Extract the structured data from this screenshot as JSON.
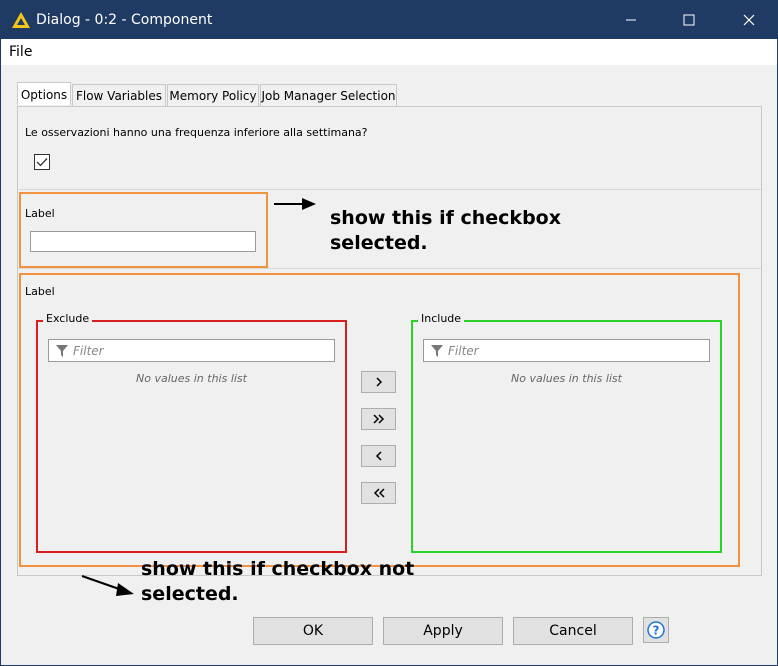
{
  "window": {
    "title": "Dialog - 0:2 - Component",
    "controls": [
      "minimize-icon",
      "maximize-icon",
      "close-icon"
    ]
  },
  "menu": {
    "file": "File"
  },
  "tabs": [
    {
      "label": "Options",
      "active": true
    },
    {
      "label": "Flow Variables",
      "active": false
    },
    {
      "label": "Memory Policy",
      "active": false
    },
    {
      "label": "Job Manager Selection",
      "active": false
    }
  ],
  "options": {
    "question": "Le osservazioni hanno una frequenza inferiore alla settimana?",
    "checkbox_checked": true,
    "text_field": {
      "label": "Label",
      "value": ""
    },
    "column_filter": {
      "label": "Label",
      "exclude": {
        "title": "Exclude",
        "placeholder": "Filter",
        "empty_text": "No values in this list",
        "border_color": "#d71f1f"
      },
      "include": {
        "title": "Include",
        "placeholder": "Filter",
        "empty_text": "No values in this list",
        "border_color": "#2ad12a"
      },
      "buttons": [
        "move-right-icon",
        "move-all-right-icon",
        "move-left-icon",
        "move-all-left-icon"
      ]
    }
  },
  "annotations": {
    "note_selected_line1": "show this if checkbox",
    "note_selected_line2": "selected.",
    "note_not_selected_line1": "show this if checkbox not",
    "note_not_selected_line2": "selected.",
    "highlight_color": "#f0923e"
  },
  "footer": {
    "ok": "OK",
    "apply": "Apply",
    "cancel": "Cancel",
    "help_icon": "help-icon"
  }
}
